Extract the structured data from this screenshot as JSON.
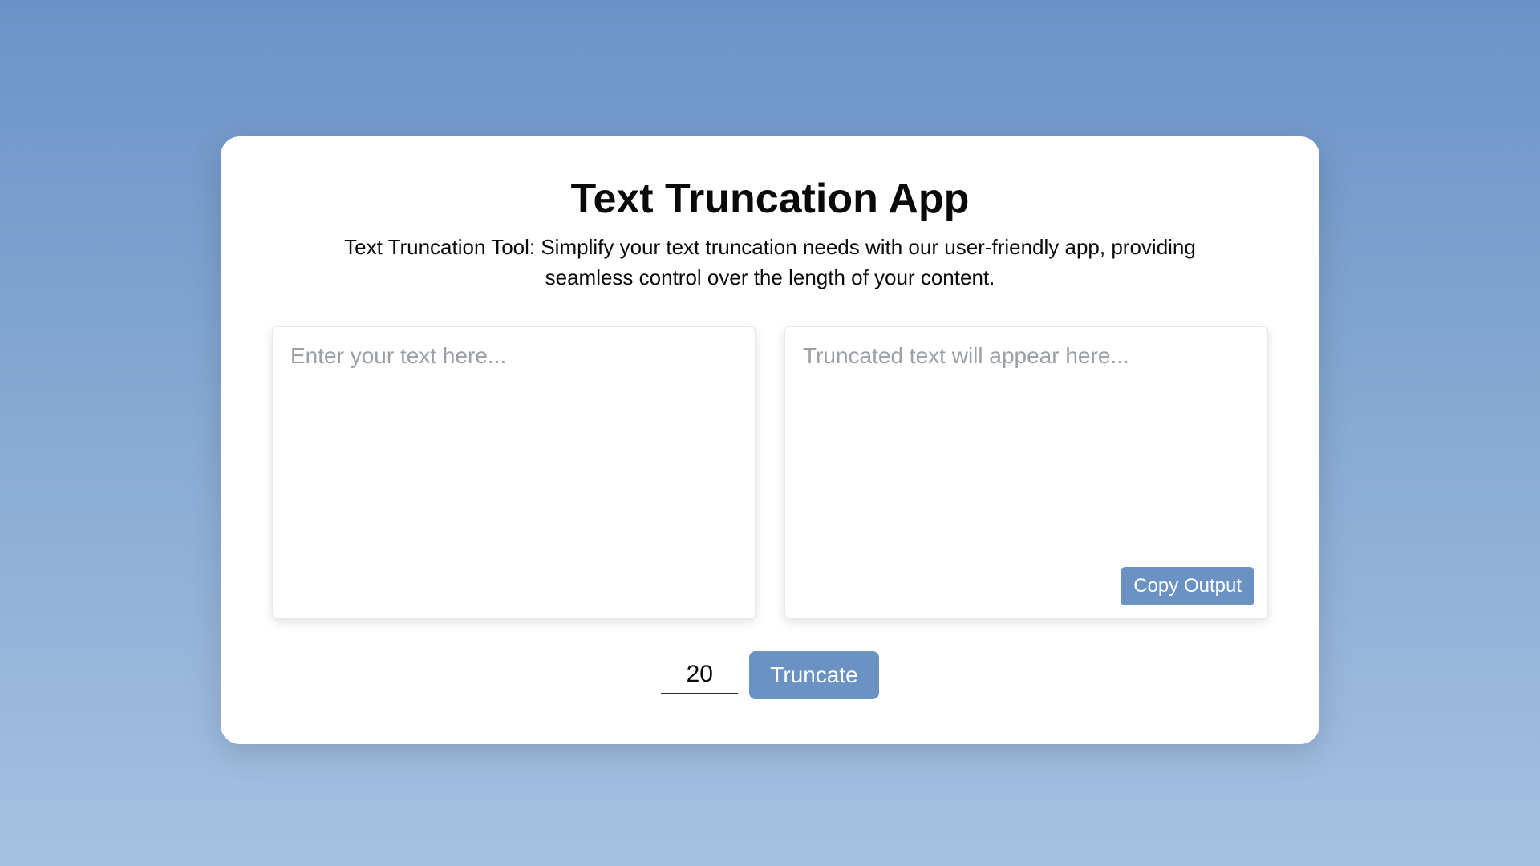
{
  "header": {
    "title": "Text Truncation App",
    "description": "Text Truncation Tool: Simplify your text truncation needs with our user-friendly app, providing seamless control over the length of your content."
  },
  "input": {
    "placeholder": "Enter your text here...",
    "value": ""
  },
  "output": {
    "placeholder": "Truncated text will appear here...",
    "value": "",
    "copy_button_label": "Copy Output"
  },
  "controls": {
    "length_value": "20",
    "truncate_button_label": "Truncate"
  },
  "colors": {
    "primary": "#6a92c3",
    "background_gradient_start": "#6a94c8",
    "background_gradient_end": "#a6c0e0"
  }
}
